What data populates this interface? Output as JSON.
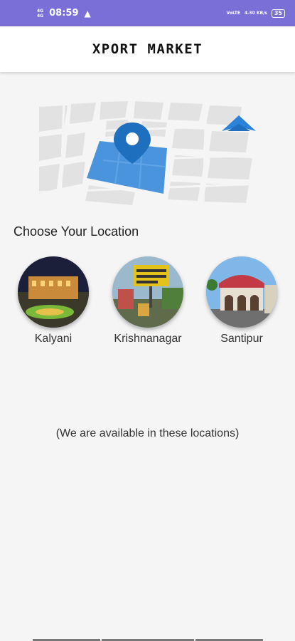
{
  "status_bar": {
    "time": "08:59",
    "network_left": [
      "4G",
      "4G"
    ],
    "network_right": [
      "VoLTE",
      "4.30 KB/s"
    ],
    "battery": "35"
  },
  "app_bar": {
    "title": "XPORT MARKET"
  },
  "hero": {
    "icon": "map-with-pin"
  },
  "locations_section": {
    "title": "Choose Your Location",
    "locations": [
      {
        "label": "Kalyani"
      },
      {
        "label": "Krishnanagar"
      },
      {
        "label": "Santipur"
      }
    ]
  },
  "availability_note": "(We are available in these locations)",
  "colors": {
    "status_bar": "#7a6fd6",
    "map_highlight": "#2b82d9",
    "pin": "#1f6fbf"
  }
}
